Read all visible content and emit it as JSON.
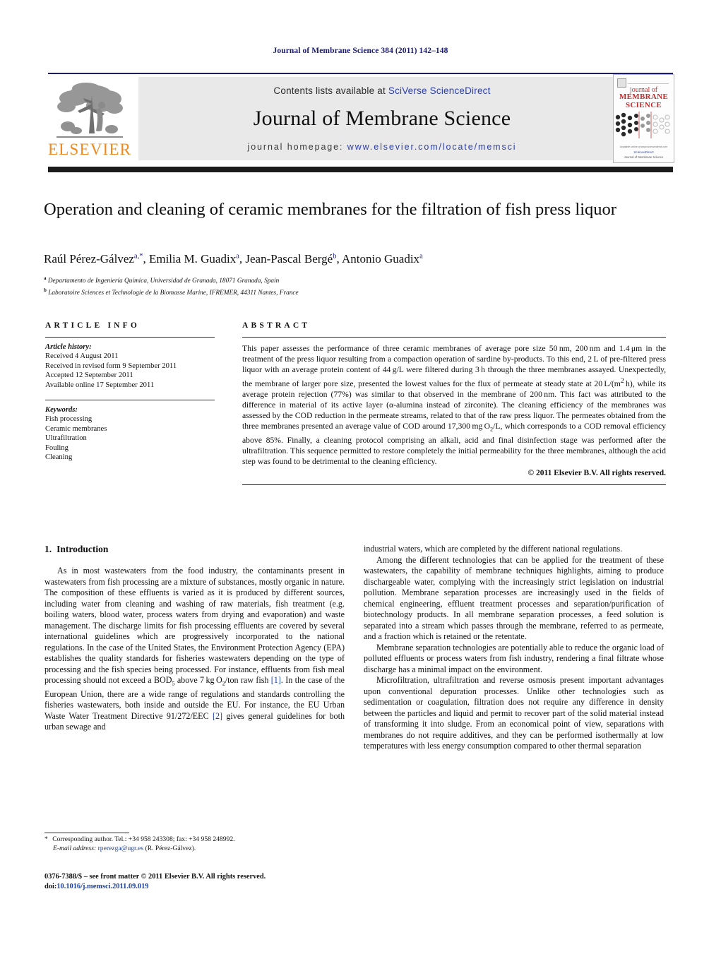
{
  "running_head": "Journal of Membrane Science 384 (2011) 142–148",
  "journal_header": {
    "contents_prefix": "Contents lists available at ",
    "contents_link": "SciVerse ScienceDirect",
    "journal_title": "Journal of Membrane Science",
    "homepage_prefix": "journal homepage: ",
    "homepage_url": "www.elsevier.com/locate/memsci",
    "publisher_logo_text": "ELSEVIER",
    "cover": {
      "line1": "journal of",
      "line2": "MEMBRANE",
      "line3": "SCIENCE",
      "foot1": "Available online at www.sciencedirect.com",
      "foot2": "ScienceDirect",
      "foot3": "Journal of Membrane Science"
    },
    "accent_blue": "#1a1a6e",
    "accent_orange": "#ee8a22",
    "band_gray": "#e9e9ea"
  },
  "article": {
    "title": "Operation and cleaning of ceramic membranes for the filtration of fish press liquor",
    "authors_html": "Raúl Pérez-Gálvez<sup>a,*</sup>, Emilia M. Guadix<sup>a</sup>, Jean-Pascal Bergé<sup>b</sup>, Antonio Guadix<sup>a</sup>",
    "affiliations": [
      {
        "marker": "a",
        "text": "Departamento de Ingeniería Química, Universidad de Granada, 18071 Granada, Spain"
      },
      {
        "marker": "b",
        "text": "Laboratoire Sciences et Technologie de la Biomasse Marine, IFREMER, 44311 Nantes, France"
      }
    ]
  },
  "article_info": {
    "heading": "ARTICLE INFO",
    "history_label": "Article history:",
    "history": [
      "Received 4 August 2011",
      "Received in revised form 9 September 2011",
      "Accepted 12 September 2011",
      "Available online 17 September 2011"
    ],
    "keywords_label": "Keywords:",
    "keywords": [
      "Fish processing",
      "Ceramic membranes",
      "Ultrafiltration",
      "Fouling",
      "Cleaning"
    ]
  },
  "abstract": {
    "heading": "ABSTRACT",
    "text_html": "This paper assesses the performance of three ceramic membranes of average pore size 50&thinsp;nm, 200&thinsp;nm and 1.4&thinsp;&mu;m in the treatment of the press liquor resulting from a compaction operation of sardine by-products. To this end, 2&thinsp;L of pre-filtered press liquor with an average protein content of 44&thinsp;g/L were filtered during 3&thinsp;h through the three membranes assayed. Unexpectedly, the membrane of larger pore size, presented the lowest values for the flux of permeate at steady state at 20&thinsp;L/(m<sup>2</sup>&thinsp;h), while its average protein rejection (77%) was similar to that observed in the membrane of 200&thinsp;nm. This fact was attributed to the difference in material of its active layer (&alpha;-alumina instead of zirconite). The cleaning efficiency of the membranes was assessed by the COD reduction in the permeate streams, related to that of the raw press liquor. The permeates obtained from the three membranes presented an average value of COD around 17,300&thinsp;mg&thinsp;O<sub>2</sub>/L, which corresponds to a COD removal efficiency above 85%. Finally, a cleaning protocol comprising an alkali, acid and final disinfection stage was performed after the ultrafiltration. This sequence permitted to restore completely the initial permeability for the three membranes, although the acid step was found to be detrimental to the cleaning efficiency.",
    "copyright": "© 2011 Elsevier B.V. All rights reserved."
  },
  "body": {
    "section_number": "1.",
    "section_title": "Introduction",
    "left_paragraphs_html": [
      "As in most wastewaters from the food industry, the contaminants present in wastewaters from fish processing are a mixture of substances, mostly organic in nature. The composition of these effluents is varied as it is produced by different sources, including water from cleaning and washing of raw materials, fish treatment (e.g. boiling waters, blood water, process waters from drying and evaporation) and waste management. The discharge limits for fish processing effluents are covered by several international guidelines which are progressively incorporated to the national regulations. In the case of the United States, the Environment Protection Agency (EPA) establishes the quality standards for fisheries wastewaters depending on the type of processing and the fish species being processed. For instance, effluents from fish meal processing should not exceed a BOD<sub>5</sub> above 7&thinsp;kg&thinsp;O<sub>2</sub>/ton raw fish <span class=\"cit\">[1]</span>. In the case of the European Union, there are a wide range of regulations and standards controlling the fisheries wastewaters, both inside and outside the EU. For instance, the EU Urban Waste Water Treatment Directive 91/272/EEC <span class=\"cit\">[2]</span> gives general guidelines for both urban sewage and"
    ],
    "right_paragraphs_html": [
      "industrial waters, which are completed by the different national regulations.",
      "Among the different technologies that can be applied for the treatment of these wastewaters, the capability of membrane techniques highlights, aiming to produce dischargeable water, complying with the increasingly strict legislation on industrial pollution. Membrane separation processes are increasingly used in the fields of chemical engineering, effluent treatment processes and separation/purification of biotechnology products. In all membrane separation processes, a feed solution is separated into a stream which passes through the membrane, referred to as permeate, and a fraction which is retained or the retentate.",
      "Membrane separation technologies are potentially able to reduce the organic load of polluted effluents or process waters from fish industry, rendering a final filtrate whose discharge has a minimal impact on the environment.",
      "Microfiltration, ultrafiltration and reverse osmosis present important advantages upon conventional depuration processes. Unlike other technologies such as sedimentation or coagulation, filtration does not require any difference in density between the particles and liquid and permit to recover part of the solid material instead of transforming it into sludge. From an economical point of view, separations with membranes do not require additives, and they can be performed isothermally at low temperatures with less energy consumption compared to other thermal separation"
    ]
  },
  "footnote": {
    "corresponding_html": "<span class=\"star\">*</span> Corresponding author. Tel.: +34 958 243308; fax: +34 958 248992.",
    "email_label": "E-mail address:",
    "email": "rperezga@ugr.es",
    "email_owner": "(R. Pérez-Gálvez).",
    "issn_line": "0376-7388/$ – see front matter © 2011 Elsevier B.V. All rights reserved.",
    "doi_label": "doi:",
    "doi_value": "10.1016/j.memsci.2011.09.019"
  }
}
